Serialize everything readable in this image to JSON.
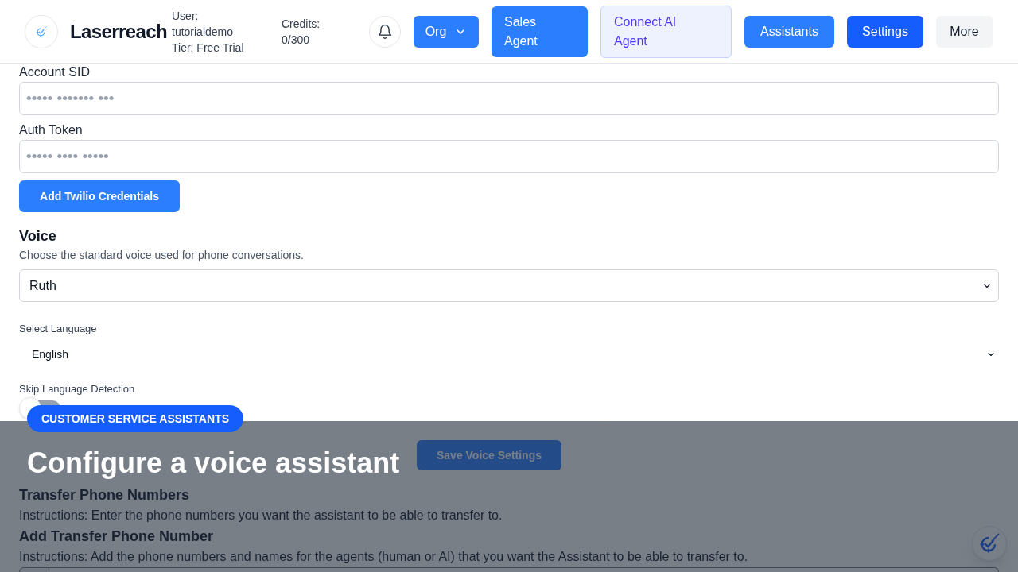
{
  "header": {
    "brand": "Laserreach",
    "user": "User: tutorialdemo",
    "tier": "Tier: Free Trial",
    "credits": "Credits: 0/300",
    "nav": [
      {
        "label": "Org",
        "kind": "menu",
        "selected": false
      },
      {
        "label": "Sales Agent",
        "kind": "primary",
        "selected": false
      },
      {
        "label": "Connect AI Agent",
        "kind": "soft",
        "selected": false
      },
      {
        "label": "Assistants",
        "kind": "primary",
        "selected": false
      },
      {
        "label": "Settings",
        "kind": "primary",
        "selected": true
      },
      {
        "label": "More",
        "kind": "neutral",
        "selected": false
      }
    ]
  },
  "twilio": {
    "fields": [
      {
        "label": "Account SID",
        "placeholder": "••••• ••••••• •••"
      },
      {
        "label": "Auth Token",
        "placeholder": "••••• •••• •••••"
      }
    ],
    "button": "Add Twilio Credentials"
  },
  "voice": {
    "title": "Voice",
    "description": "Choose the standard voice used for phone conversations.",
    "voice_value": "Ruth",
    "language_label": "Select Language",
    "language_value": "English",
    "skip_detection_label": "Skip Language Detection",
    "skip_detection_on": false,
    "save_button": "Save Voice Settings"
  },
  "transfer": {
    "title": "Transfer Phone Numbers",
    "instructions": "Instructions: Enter the phone numbers you want the assistant to be able to transfer to.",
    "add_title": "Add Transfer Phone Number",
    "add_instructions": "Instructions: Add the phone numbers and names for the agents (human or AI) that you want the Assistant to be able to transfer to."
  },
  "tutorial_overlay": {
    "badge": "CUSTOMER SERVICE ASSISTANTS",
    "title": "Configure a voice assistant"
  }
}
